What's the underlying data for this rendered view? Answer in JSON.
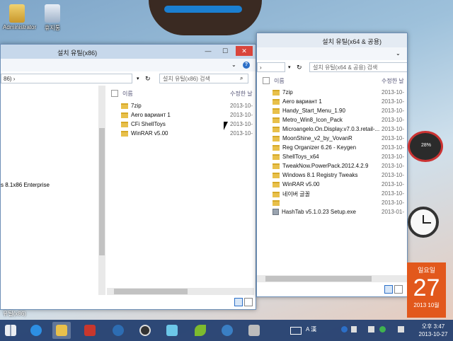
{
  "desktop": {
    "icons": [
      {
        "label": "Administrator",
        "icon": "user-folder-icon"
      },
      {
        "label": "휴지통",
        "icon": "recycle-bin-icon"
      }
    ]
  },
  "left_window": {
    "title": "설치 유틸(x86)",
    "address": "86) ›",
    "search_placeholder": "설치 유틸(x86) 검색",
    "col_name": "이름",
    "col_date": "수정한 날",
    "nav_text": "s 8.1x86 Enterprise",
    "bottom_text": "유틸(x86)",
    "rows": [
      {
        "name": "7zip",
        "date": "2013-10-"
      },
      {
        "name": "Aero вариант 1",
        "date": "2013-10-"
      },
      {
        "name": "CFi ShellToys",
        "date": "2013-10-"
      },
      {
        "name": "WinRAR v5.00",
        "date": "2013-10-"
      }
    ]
  },
  "right_window": {
    "title": "설치 유틸(x64 & 공용)",
    "address": "›",
    "search_placeholder": "설치 유틸(x64 & 공용) 검색",
    "col_name": "이름",
    "col_date": "수정한 날",
    "rows": [
      {
        "name": "7zip",
        "date": "2013-10-",
        "type": "folder"
      },
      {
        "name": "Aero вариант 1",
        "date": "2013-10-",
        "type": "folder"
      },
      {
        "name": "Handy_Start_Menu_1.90",
        "date": "2013-10-",
        "type": "folder"
      },
      {
        "name": "Metro_Win8_Icon_Pack",
        "date": "2013-10-",
        "type": "folder"
      },
      {
        "name": "Microangelo.On.Display.v7.0.3.retail-...",
        "date": "2013-10-",
        "type": "folder"
      },
      {
        "name": "MoonShine_v2_by_VovanR",
        "date": "2013-10-",
        "type": "folder"
      },
      {
        "name": "Reg Organizer 6.26 - Keygen",
        "date": "2013-10-",
        "type": "folder"
      },
      {
        "name": "ShellToys_x64",
        "date": "2013-10-",
        "type": "folder"
      },
      {
        "name": "TweakNow.PowerPack.2012.4.2.9",
        "date": "2013-10-",
        "type": "folder"
      },
      {
        "name": "Windows 8.1 Registry Tweaks",
        "date": "2013-10-",
        "type": "folder"
      },
      {
        "name": "WinRAR v5.00",
        "date": "2013-10-",
        "type": "folder"
      },
      {
        "name": "네이버 글꼴",
        "date": "2013-10-",
        "type": "folder"
      },
      {
        "name": "",
        "date": "2013-10-",
        "type": "folder"
      },
      {
        "name": "HashTab v5.1.0.23 Setup.exe",
        "date": "2013-01-",
        "type": "exe"
      }
    ]
  },
  "gadgets": {
    "calendar_weekday": "일요일",
    "calendar_day": "27",
    "calendar_month": "2013 10월",
    "gauge_value": "28%"
  },
  "taskbar": {
    "apps": [
      "start-icon",
      "ie-icon",
      "explorer-icon",
      "red-app-icon",
      "power-icon",
      "clock-app-icon",
      "notepad-icon",
      "leaf-app-icon",
      "media-icon",
      "tools-icon"
    ],
    "tray_text": "A 漢",
    "time": "오후 3:47",
    "date": "2013-10-27"
  }
}
